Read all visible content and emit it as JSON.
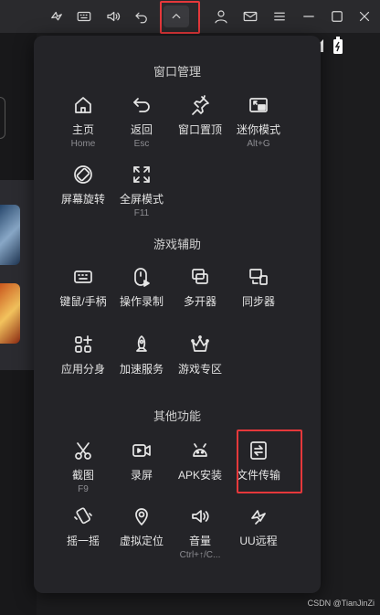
{
  "menu": {
    "sections": [
      {
        "title": "窗口管理",
        "items": [
          {
            "label": "主页",
            "sub": "Home",
            "icon": "home-icon"
          },
          {
            "label": "返回",
            "sub": "Esc",
            "icon": "back-icon"
          },
          {
            "label": "窗口置顶",
            "sub": "",
            "icon": "pin-icon"
          },
          {
            "label": "迷你模式",
            "sub": "Alt+G",
            "icon": "mini-mode-icon"
          },
          {
            "label": "屏幕旋转",
            "sub": "",
            "icon": "rotate-screen-icon"
          },
          {
            "label": "全屏模式",
            "sub": "F11",
            "icon": "fullscreen-icon"
          }
        ]
      },
      {
        "title": "游戏辅助",
        "items": [
          {
            "label": "键鼠/手柄",
            "sub": "",
            "icon": "keyboard-icon"
          },
          {
            "label": "操作录制",
            "sub": "",
            "icon": "record-icon"
          },
          {
            "label": "多开器",
            "sub": "",
            "icon": "multi-instance-icon"
          },
          {
            "label": "同步器",
            "sub": "",
            "icon": "sync-icon"
          },
          {
            "label": "应用分身",
            "sub": "",
            "icon": "app-clone-icon"
          },
          {
            "label": "加速服务",
            "sub": "",
            "icon": "rocket-icon"
          },
          {
            "label": "游戏专区",
            "sub": "",
            "icon": "crown-icon"
          }
        ]
      },
      {
        "title": "其他功能",
        "items": [
          {
            "label": "截图",
            "sub": "F9",
            "icon": "scissors-icon"
          },
          {
            "label": "录屏",
            "sub": "",
            "icon": "screen-record-icon"
          },
          {
            "label": "APK安装",
            "sub": "",
            "icon": "android-icon"
          },
          {
            "label": "文件传输",
            "sub": "",
            "icon": "file-transfer-icon"
          },
          {
            "label": "摇一摇",
            "sub": "",
            "icon": "shake-icon"
          },
          {
            "label": "虚拟定位",
            "sub": "",
            "icon": "location-icon"
          },
          {
            "label": "音量",
            "sub": "Ctrl+↑/C...",
            "icon": "volume-icon"
          },
          {
            "label": "UU远程",
            "sub": "",
            "icon": "uu-remote-icon"
          }
        ]
      }
    ]
  },
  "topbar": {
    "icons": [
      "uu-logo-icon",
      "keyboard-icon",
      "volume-icon",
      "undo-icon",
      "chevron-up-icon",
      "user-icon",
      "mail-icon",
      "menu-icon",
      "minimize-icon",
      "maximize-icon",
      "close-icon"
    ]
  },
  "watermark": "CSDN @TianJinZi",
  "colors": {
    "highlight": "#e5383b",
    "panel": "#242428",
    "topbar": "#2a2a2d"
  }
}
